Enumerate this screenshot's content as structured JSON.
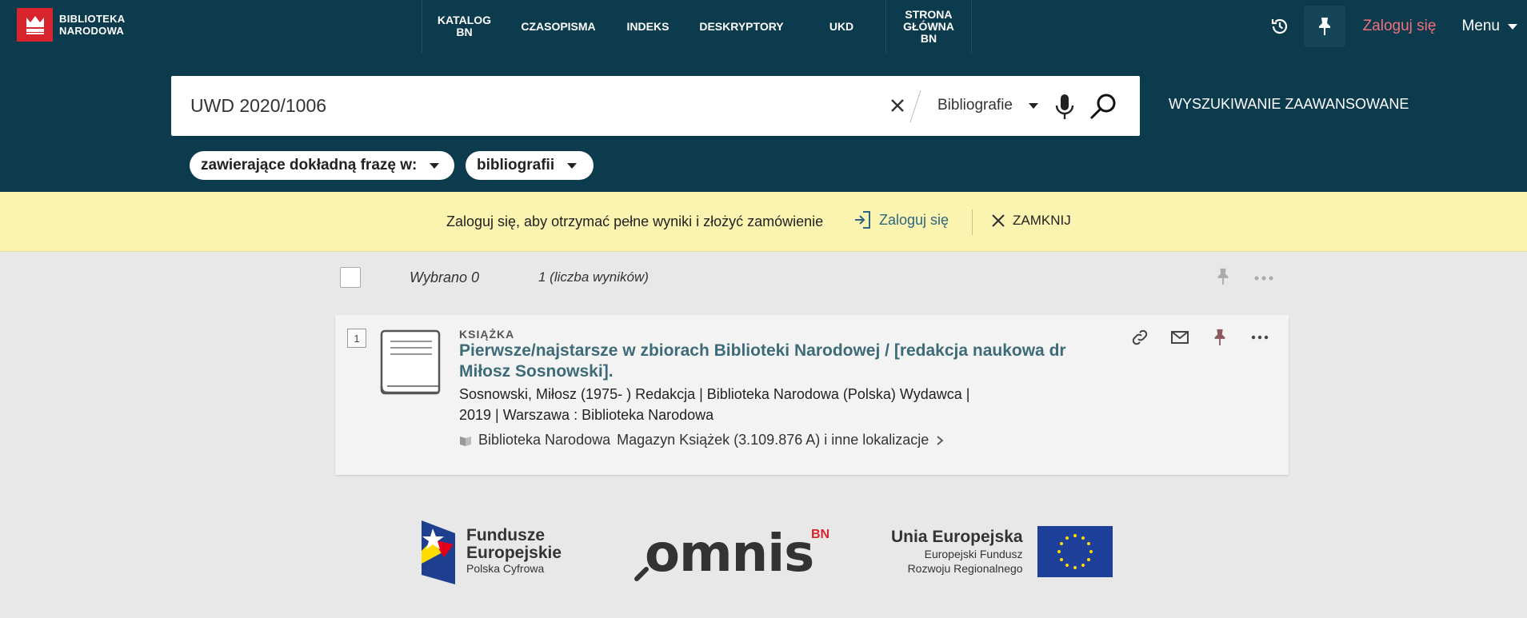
{
  "brand": {
    "line1": "BIBLIOTEKA",
    "line2": "NARODOWA",
    "accent": "#d9232d"
  },
  "nav": {
    "items": [
      {
        "label": "KATALOG\nBN"
      },
      {
        "label": "CZASOPISMA"
      },
      {
        "label": "INDEKS"
      },
      {
        "label": "DESKRYPTORY"
      },
      {
        "label": "UKD"
      },
      {
        "label": "STRONA\nGŁÓWNA\nBN"
      }
    ],
    "login": "Zaloguj się",
    "menu": "Menu"
  },
  "search": {
    "value": "UWD 2020/1006",
    "scope": "Bibliografie",
    "advanced": "WYSZUKIWANIE ZAAWANSOWANE",
    "filter_mode": "zawierające dokładną frazę w:",
    "filter_field": "bibliografii"
  },
  "notice": {
    "text": "Zaloguj się, aby otrzymać pełne wyniki i złożyć zamówienie",
    "login": "Zaloguj się",
    "close": "ZAMKNIJ"
  },
  "results": {
    "selected": "Wybrano 0",
    "count": "1 (liczba wyników)",
    "items": [
      {
        "number": "1",
        "type": "KSIĄŻKA",
        "title": "Pierwsze/najstarsze w zbiorach Biblioteki Narodowej / [redakcja naukowa dr Miłosz Sosnowski].",
        "authors": "Sosnowski, Miłosz (1975- ) Redakcja | Biblioteka Narodowa (Polska) Wydawca |",
        "publication": "2019 | Warszawa : Biblioteka Narodowa",
        "library": "Biblioteka Narodowa",
        "location": "Magazyn Książek (3.109.876 A) i inne lokalizacje"
      }
    ]
  },
  "footer": {
    "fe_line1": "Fundusze",
    "fe_line2": "Europejskie",
    "fe_line3": "Polska Cyfrowa",
    "omnis": "omnis",
    "omnis_sup": "BN",
    "ue_line1": "Unia Europejska",
    "ue_line2": "Europejski Fundusz",
    "ue_line3": "Rozwoju Regionalnego"
  }
}
